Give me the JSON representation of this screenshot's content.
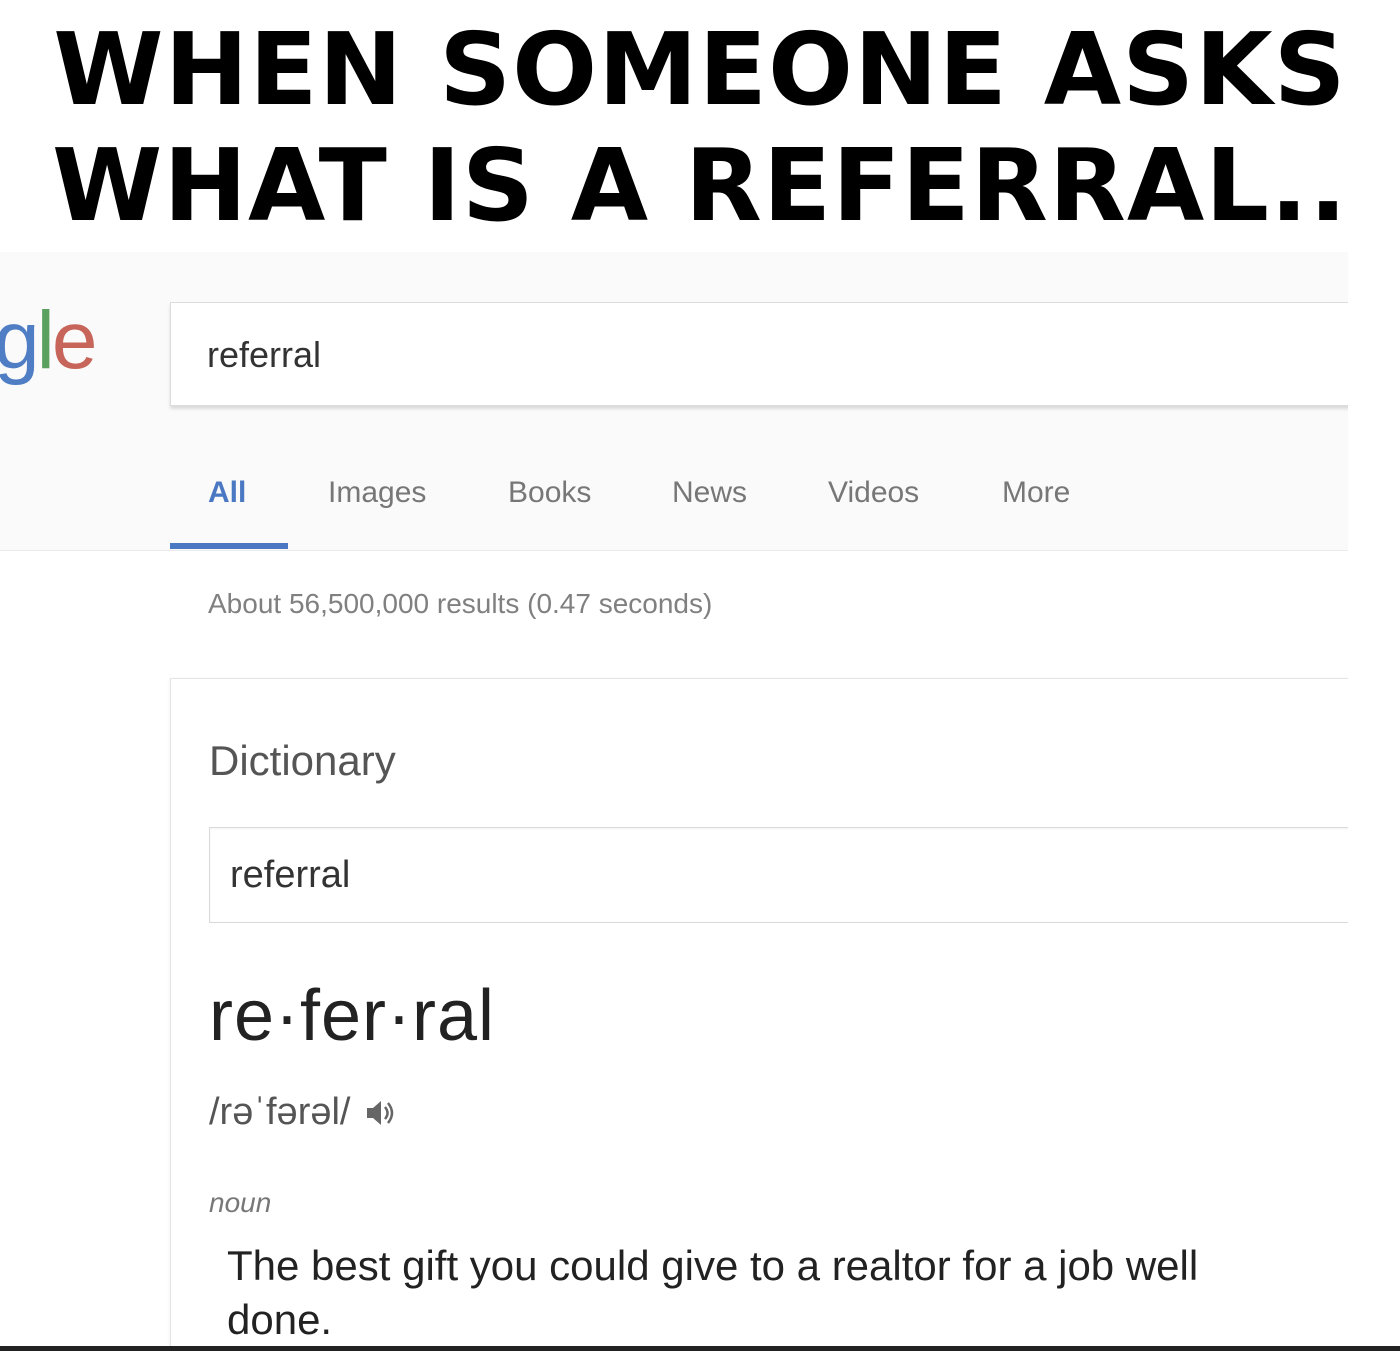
{
  "caption": {
    "line1": "WHEN SOMEONE ASKS",
    "line2": "WHAT IS A REFERRAL.."
  },
  "logo": {
    "text_part1": "g",
    "text_part2": "l",
    "text_part3": "e",
    "colors": {
      "g": "#4f7ec4",
      "l": "#5aa05f",
      "e": "#c8655a"
    }
  },
  "search": {
    "value": "referral"
  },
  "tabs": [
    {
      "label": "All",
      "active": true
    },
    {
      "label": "Images",
      "active": false
    },
    {
      "label": "Books",
      "active": false
    },
    {
      "label": "News",
      "active": false
    },
    {
      "label": "Videos",
      "active": false
    },
    {
      "label": "More",
      "active": false
    }
  ],
  "results": {
    "count_text": "About 56,500,000 results (0.47 seconds)"
  },
  "dictionary": {
    "title": "Dictionary",
    "search_value": "referral",
    "headword": "re·fer·ral",
    "pronunciation": "/rəˈfərəl/",
    "speaker_icon": "speaker-icon",
    "part_of_speech": "noun",
    "definition": "The best gift you could give to a realtor for a job well done."
  },
  "colors": {
    "accent": "#4a78c2",
    "muted_text": "#808080"
  }
}
